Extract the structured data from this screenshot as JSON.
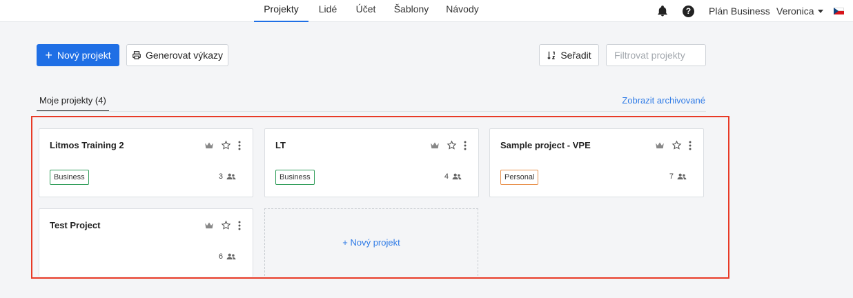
{
  "nav": {
    "tabs": [
      "Projekty",
      "Lidé",
      "Účet",
      "Šablony",
      "Návody"
    ],
    "active_tab": "Projekty",
    "plan_label": "Plán Business",
    "user_name": "Veronica",
    "bell_icon": "bell-icon",
    "help_icon": "help-icon",
    "flag_icon": "czech-flag-icon"
  },
  "toolbar": {
    "new_project_label": "Nový projekt",
    "generate_reports_label": "Generovat výkazy",
    "sort_label": "Seřadit",
    "filter_placeholder": "Filtrovat projekty",
    "filter_value": ""
  },
  "section": {
    "tab_label": "Moje projekty (4)",
    "archived_link": "Zobrazit archivované"
  },
  "projects": [
    {
      "title": "Litmos Training 2",
      "badge": "Business",
      "members": "3"
    },
    {
      "title": "LT",
      "badge": "Business",
      "members": "4"
    },
    {
      "title": "Sample project - VPE",
      "badge": "Personal",
      "members": "7"
    },
    {
      "title": "Test Project",
      "badge": "",
      "members": "6"
    }
  ],
  "new_project_card_label": "+ Nový projekt",
  "colors": {
    "accent": "#1f6fe5",
    "link": "#2f7be6",
    "business_badge": "#2e9c58",
    "personal_badge": "#e8904a",
    "highlight": "#e83a26"
  }
}
